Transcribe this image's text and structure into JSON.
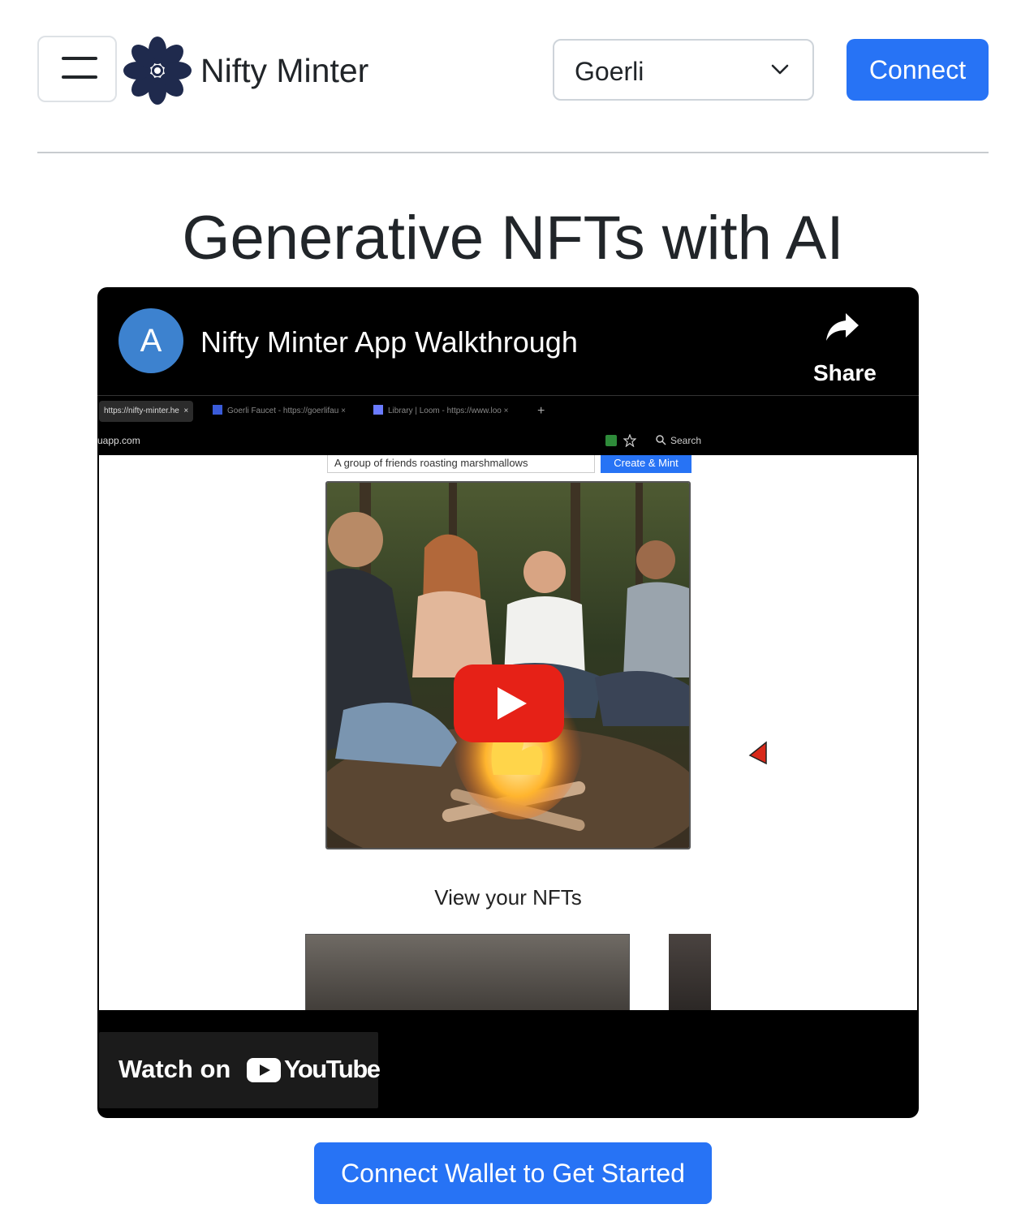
{
  "header": {
    "brand": "Nifty Minter",
    "network_selected": "Goerli",
    "connect_label": "Connect"
  },
  "main": {
    "title": "Generative NFTs with AI",
    "cta_label": "Connect Wallet to Get Started"
  },
  "video": {
    "channel_initial": "A",
    "title": "Nifty Minter App Walkthrough",
    "share_label": "Share",
    "watch_on_label": "Watch on",
    "youtube_label": "YouTube",
    "recording": {
      "tabs": [
        "https://nifty-minter.he",
        "Goerli Faucet - https://goerlifau",
        "Library | Loom - https://www.loo"
      ],
      "url": "uapp.com",
      "search_label": "Search",
      "prompt_text": "A group of friends roasting marshmallows",
      "mint_label": "Create & Mint",
      "view_nfts_heading": "View your NFTs"
    }
  },
  "colors": {
    "primary": "#2773f5",
    "logo": "#1f2a4d",
    "youtube_red": "#e62117",
    "avatar": "#3d82cf"
  }
}
